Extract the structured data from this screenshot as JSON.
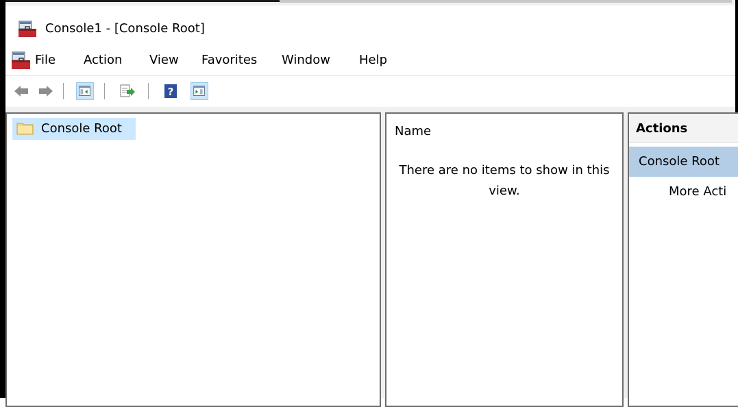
{
  "window": {
    "title": "Console1 - [Console Root]",
    "app_icon": "mmc-toolbox-icon"
  },
  "menubar": {
    "items": [
      {
        "label": "File"
      },
      {
        "label": "Action"
      },
      {
        "label": "View"
      },
      {
        "label": "Favorites"
      },
      {
        "label": "Window"
      },
      {
        "label": "Help"
      }
    ]
  },
  "toolbar": {
    "buttons": [
      {
        "icon": "back-arrow-icon"
      },
      {
        "icon": "forward-arrow-icon"
      },
      {
        "icon": "show-hide-console-tree-icon"
      },
      {
        "icon": "export-list-icon"
      },
      {
        "icon": "help-icon"
      },
      {
        "icon": "show-hide-action-pane-icon"
      }
    ]
  },
  "tree": {
    "items": [
      {
        "label": "Console Root",
        "icon": "folder-icon",
        "selected": true
      }
    ]
  },
  "list": {
    "column_header": "Name",
    "empty_message": "There are no items to show in this view."
  },
  "actions": {
    "header": "Actions",
    "section_title": "Console Root",
    "more_actions": "More Acti"
  },
  "colors": {
    "selection": "#cce8ff",
    "actions_section": "#b3cde6",
    "help_blue": "#2d4f9e",
    "toolbox_red": "#c0282e"
  }
}
